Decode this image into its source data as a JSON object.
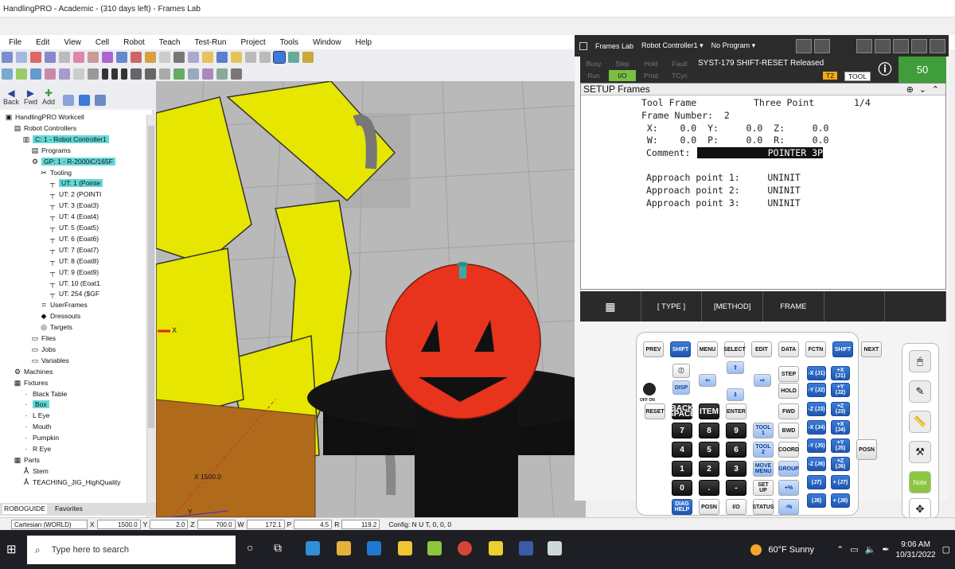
{
  "window": {
    "title": "HandlingPRO - Academic - (310 days left) - Frames Lab"
  },
  "menu": [
    "File",
    "Edit",
    "View",
    "Cell",
    "Robot",
    "Teach",
    "Test-Run",
    "Project",
    "Tools",
    "Window",
    "Help"
  ],
  "nav": {
    "back": "Back",
    "fwd": "Fwd",
    "add": "Add"
  },
  "tree": {
    "items": [
      {
        "label": "HandlingPRO Workcell",
        "lvl": 0,
        "icon": "workcell-icon"
      },
      {
        "label": "Robot Controllers",
        "lvl": 1,
        "icon": "folder-icon"
      },
      {
        "label": "C: 1 - Robot Controller1",
        "lvl": 2,
        "icon": "controller-icon",
        "sel": true
      },
      {
        "label": "Programs",
        "lvl": 3,
        "icon": "folder-icon"
      },
      {
        "label": "GP: 1 - R-2000iC/165F",
        "lvl": 3,
        "icon": "robot-icon",
        "sel": true
      },
      {
        "label": "Tooling",
        "lvl": 4,
        "icon": "tooling-icon"
      },
      {
        "label": "UT: 1  (Pointe",
        "lvl": 5,
        "icon": "tool-icon",
        "sel": true
      },
      {
        "label": "UT: 2  (POINTI",
        "lvl": 5,
        "icon": "tool-icon"
      },
      {
        "label": "UT: 3  (Eoat3)",
        "lvl": 5,
        "icon": "tool-icon"
      },
      {
        "label": "UT: 4  (Eoat4)",
        "lvl": 5,
        "icon": "tool-icon"
      },
      {
        "label": "UT: 5  (Eoat5)",
        "lvl": 5,
        "icon": "tool-icon"
      },
      {
        "label": "UT: 6  (Eoat6)",
        "lvl": 5,
        "icon": "tool-icon"
      },
      {
        "label": "UT: 7  (Eoat7)",
        "lvl": 5,
        "icon": "tool-icon"
      },
      {
        "label": "UT: 8  (Eoat8)",
        "lvl": 5,
        "icon": "tool-icon"
      },
      {
        "label": "UT: 9  (Eoat9)",
        "lvl": 5,
        "icon": "tool-icon"
      },
      {
        "label": "UT: 10  (Eoat1",
        "lvl": 5,
        "icon": "tool-icon"
      },
      {
        "label": "UT: 254  ($GF",
        "lvl": 5,
        "icon": "tool-icon"
      },
      {
        "label": "UserFrames",
        "lvl": 4,
        "icon": "userframes-icon"
      },
      {
        "label": "Dressouts",
        "lvl": 4,
        "icon": "dressouts-icon"
      },
      {
        "label": "Targets",
        "lvl": 4,
        "icon": "target-icon"
      },
      {
        "label": "Files",
        "lvl": 3,
        "icon": "files-icon"
      },
      {
        "label": "Jobs",
        "lvl": 3,
        "icon": "jobs-icon"
      },
      {
        "label": "Variables",
        "lvl": 3,
        "icon": "variables-icon"
      },
      {
        "label": "Machines",
        "lvl": 1,
        "icon": "machines-icon"
      },
      {
        "label": "Fixtures",
        "lvl": 1,
        "icon": "fixtures-icon"
      },
      {
        "label": "Black Table",
        "lvl": 2,
        "icon": "part-icon"
      },
      {
        "label": "Box",
        "lvl": 2,
        "icon": "part-icon",
        "sel": true
      },
      {
        "label": "L Eye",
        "lvl": 2,
        "icon": "part-icon"
      },
      {
        "label": "Mouth",
        "lvl": 2,
        "icon": "part-icon"
      },
      {
        "label": "Pumpkin",
        "lvl": 2,
        "icon": "part-icon"
      },
      {
        "label": "R Eye",
        "lvl": 2,
        "icon": "part-icon"
      },
      {
        "label": "Parts",
        "lvl": 1,
        "icon": "parts-icon"
      },
      {
        "label": "Stem",
        "lvl": 2,
        "icon": "stem-icon"
      },
      {
        "label": "TEACHING_JIG_HighQuality",
        "lvl": 2,
        "icon": "stem-icon"
      }
    ]
  },
  "tabs": {
    "roboguide": "ROBOGUIDE",
    "favorites": "Favorites"
  },
  "status": {
    "frame": "Cartesian (WORLD)",
    "x_label": "X",
    "x": "1500.0",
    "y_label": "Y",
    "y": "2.0",
    "z_label": "Z",
    "z": "700.0",
    "w_label": "W",
    "w": "172.1",
    "p_label": "P",
    "p": "4.5",
    "r_label": "R",
    "r": "119.2",
    "config": "Config: N U T, 0, 0, 0"
  },
  "viewport": {
    "axis_x": "X 1500.0",
    "axis_y": "Y",
    "axis_small": "X"
  },
  "pendant": {
    "header": {
      "app": "Frames Lab",
      "controller": "Robot Controller1 ▾",
      "program": "No Program ▾"
    },
    "leds": [
      "Busy",
      "Step",
      "Hold",
      "Fault",
      "Run",
      "I/O",
      "Prod",
      "TCyc"
    ],
    "alarm": "SYST-179 SHIFT-RESET Released",
    "mode": "T2",
    "coord": "TOOL",
    "override": "50",
    "screen_title": "SETUP Frames",
    "lines": {
      "l1a": "Tool Frame",
      "l1b": "Three Point",
      "l1c": "1/4",
      "l2": "Frame Number:  2",
      "xyz": " X:    0.0  Y:     0.0  Z:     0.0",
      "wpr": " W:    0.0  P:     0.0  R:     0.0",
      "comment_label": "Comment:",
      "comment": "POINTER 3P",
      "ap1": "Approach point 1:     UNINIT",
      "ap2": "Approach point 2:     UNINIT",
      "ap3": "Approach point 3:     UNINIT"
    },
    "fkeys": [
      "",
      "[ TYPE ]",
      "[METHOD]",
      "FRAME",
      "",
      ""
    ]
  },
  "keys": {
    "prev": "PREV",
    "shift": "SHIFT",
    "menu": "MENU",
    "select": "SELECT",
    "edit": "EDIT",
    "data": "DATA",
    "fctn": "FCTN",
    "next": "NEXT",
    "disp": "DISP",
    "step": "STEP",
    "hold": "HOLD",
    "fwd": "FWD",
    "bwd": "BWD",
    "reset": "RESET",
    "bksp": "BACK SPACE",
    "item": "ITEM",
    "enter": "ENTER",
    "tool1": "TOOL 1",
    "tool2": "TOOL 2",
    "coord": "COORD",
    "group": "GROUP",
    "move": "MOVE MENU",
    "setup": "SET UP",
    "diag": "DIAG HELP",
    "posn": "POSN",
    "io": "I/O",
    "status": "STATUS",
    "posn2": "POSN",
    "offon": "OFF  ON",
    "n7": "7",
    "n8": "8",
    "n9": "9",
    "n4": "4",
    "n5": "5",
    "n6": "6",
    "n1": "1",
    "n2": "2",
    "n3": "3",
    "n0": "0",
    "dot": ".",
    "minus": "-",
    "jx": "-X (J1)",
    "px": "+X (J1)",
    "jy": "-Y (J2)",
    "py": "+Y (J2)",
    "jz": "-Z (J3)",
    "pz": "+Z (J3)",
    "jx4": "-X (J4)",
    "px4": "+X (J4)",
    "jy5": "-Y (J5)",
    "py5": "+Y (J5)",
    "jz6": "-Z (J6)",
    "pz6": "+Z (J6)",
    "j7m": "(J7)",
    "j7p": "+ (J7)",
    "j8m": "(J8)",
    "j8p": "+ (J8)",
    "plus_pct": "+%",
    "minus_pct": "-%"
  },
  "taskbar": {
    "search": "Type here to search",
    "weather": "60°F  Sunny",
    "time": "9:06 AM",
    "date": "10/31/2022"
  },
  "rtools": {
    "note": "Note"
  }
}
